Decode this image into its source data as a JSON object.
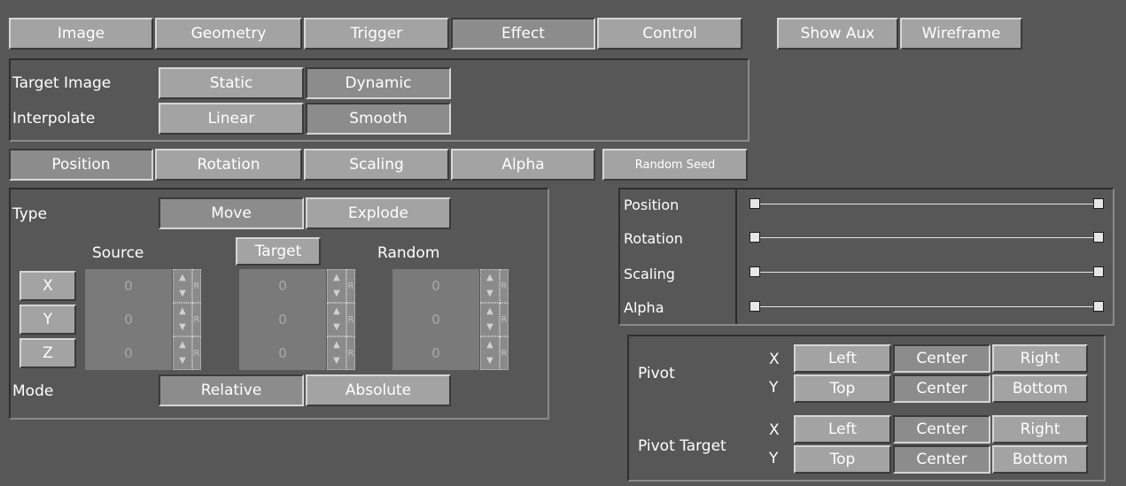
{
  "main_tabs": [
    "Image",
    "Geometry",
    "Trigger",
    "Effect",
    "Control"
  ],
  "active_main_tab": "Effect",
  "right_buttons": {
    "show_aux": "Show Aux",
    "wireframe": "Wireframe"
  },
  "target_image": {
    "label": "Target Image",
    "options": [
      "Static",
      "Dynamic"
    ],
    "selected": "Dynamic"
  },
  "interpolate": {
    "label": "Interpolate",
    "options": [
      "Linear",
      "Smooth"
    ],
    "selected": "Smooth"
  },
  "sub_tabs": [
    "Position",
    "Rotation",
    "Scaling",
    "Alpha"
  ],
  "active_sub_tab": "Position",
  "random_seed": "Random Seed",
  "type": {
    "label": "Type",
    "options": [
      "Move",
      "Explode"
    ],
    "selected": "Move"
  },
  "columns": {
    "source": "Source",
    "target": "Target",
    "random": "Random"
  },
  "axes": [
    "X",
    "Y",
    "Z"
  ],
  "values": {
    "source": [
      "0",
      "0",
      "0"
    ],
    "target": [
      "0",
      "0",
      "0"
    ],
    "random": [
      "0",
      "0",
      "0"
    ]
  },
  "spin_r": "R",
  "mode": {
    "label": "Mode",
    "options": [
      "Relative",
      "Absolute"
    ],
    "selected": "Relative"
  },
  "sliders": [
    {
      "label": "Position",
      "value": 1.0
    },
    {
      "label": "Rotation",
      "value": 1.0
    },
    {
      "label": "Scaling",
      "value": 1.0
    },
    {
      "label": "Alpha",
      "value": 1.0
    }
  ],
  "pivot": {
    "label": "Pivot",
    "x_label": "X",
    "y_label": "Y",
    "x_options": [
      "Left",
      "Center",
      "Right"
    ],
    "y_options": [
      "Top",
      "Center",
      "Bottom"
    ],
    "x_selected": "Center",
    "y_selected": "Center"
  },
  "pivot_target": {
    "label": "Pivot Target",
    "x_label": "X",
    "y_label": "Y",
    "x_options": [
      "Left",
      "Center",
      "Right"
    ],
    "y_options": [
      "Top",
      "Center",
      "Bottom"
    ],
    "x_selected": "Center",
    "y_selected": "Center"
  }
}
